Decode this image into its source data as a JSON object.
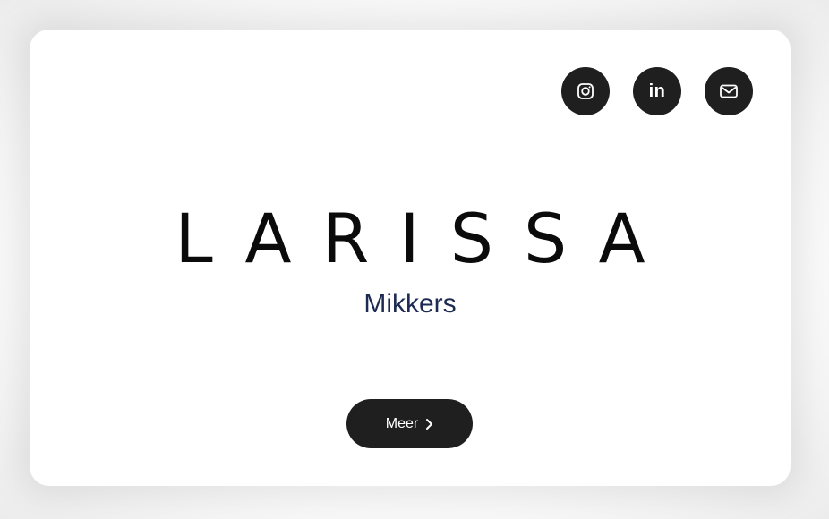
{
  "profile": {
    "first_name": "LARISSA",
    "last_name": "Mikkers"
  },
  "social": {
    "instagram_icon": "instagram-icon",
    "linkedin_label": "in",
    "mail_icon": "mail-icon"
  },
  "cta": {
    "label": "Meer",
    "arrow": "›"
  },
  "colors": {
    "button_bg": "#1f1f1f",
    "last_name": "#1d2a52",
    "card_bg": "#ffffff"
  }
}
